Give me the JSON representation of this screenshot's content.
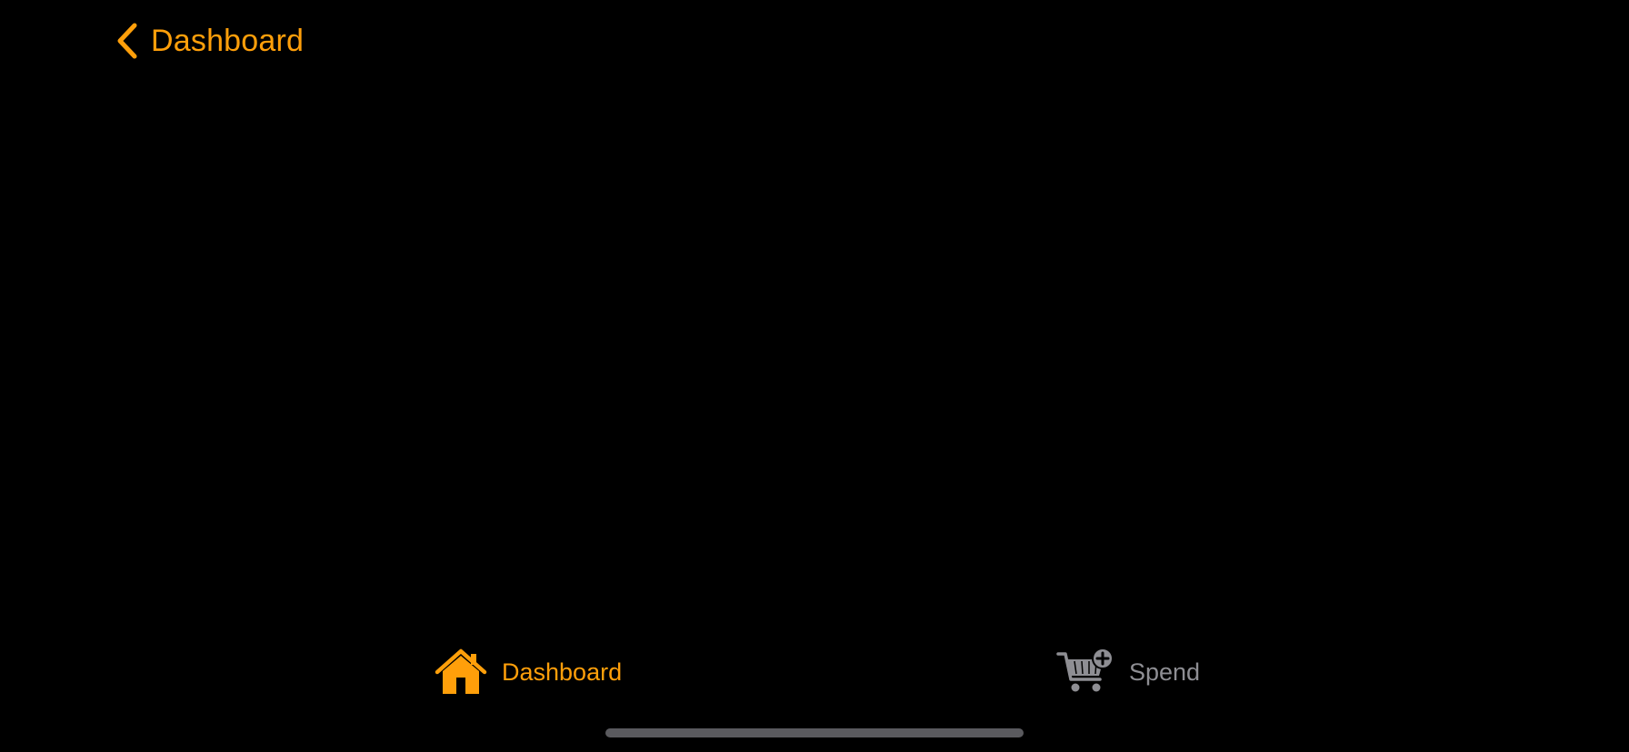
{
  "nav": {
    "back_label": "Dashboard",
    "back_icon": "chevron-left-icon"
  },
  "tab_bar": {
    "tabs": [
      {
        "label": "Dashboard",
        "icon": "house-icon",
        "selected": true
      },
      {
        "label": "Spend",
        "icon": "cart-plus-icon",
        "selected": false
      }
    ]
  },
  "colors": {
    "accent": "#FF9F0A",
    "inactive": "#8E8E93",
    "background": "#000000",
    "home_indicator": "#5A5A5E"
  }
}
